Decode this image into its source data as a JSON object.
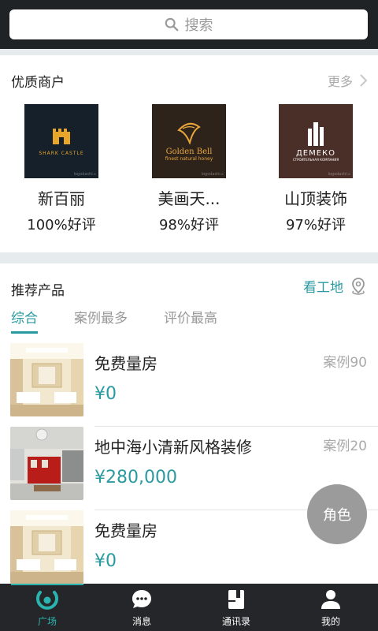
{
  "search": {
    "placeholder": "搜索"
  },
  "merchants_section": {
    "title": "优质商户",
    "more_label": "更多",
    "items": [
      {
        "name": "新百丽",
        "rating": "100%好评",
        "logo_text": "SHARK CASTLE",
        "logo_bg": "#15202a",
        "logo_color": "#e8a62a"
      },
      {
        "name": "美画天...",
        "rating": "98%好评",
        "logo_text": "Golden Bell",
        "logo_sub": "finest natural honey",
        "logo_bg": "#2e231b",
        "logo_color": "#e7a53c"
      },
      {
        "name": "山顶装饰",
        "rating": "97%好评",
        "logo_text": "ДЕМЕКО",
        "logo_sub": "СТРОИТЕЛЬНАЯ КОМПАНИЯ",
        "logo_bg": "#4a2f28",
        "logo_color": "#ffffff"
      }
    ],
    "logo_watermark": "logodashi.c"
  },
  "products_section": {
    "title": "推荐产品",
    "site_link": "看工地",
    "tabs": [
      "综合",
      "案例最多",
      "评价最高"
    ],
    "active_tab": 0,
    "items": [
      {
        "title": "免费量房",
        "price": "¥0",
        "cases": "案例90",
        "thumb": "living-room"
      },
      {
        "title": "地中海小清新风格装修",
        "price": "¥280,000",
        "cases": "案例20",
        "thumb": "red-kitchen"
      },
      {
        "title": "免费量房",
        "price": "¥0",
        "cases": "",
        "thumb": "living-room"
      }
    ]
  },
  "floating_button": {
    "label": "角色"
  },
  "bottom_nav": {
    "items": [
      {
        "label": "广场",
        "icon": "plaza-icon",
        "active": true
      },
      {
        "label": "消息",
        "icon": "chat-icon",
        "active": false
      },
      {
        "label": "通讯录",
        "icon": "contacts-icon",
        "active": false
      },
      {
        "label": "我的",
        "icon": "profile-icon",
        "active": false
      }
    ]
  },
  "colors": {
    "accent": "#2a9aa0",
    "topbar": "#1f2326",
    "bottombar": "#252629"
  }
}
